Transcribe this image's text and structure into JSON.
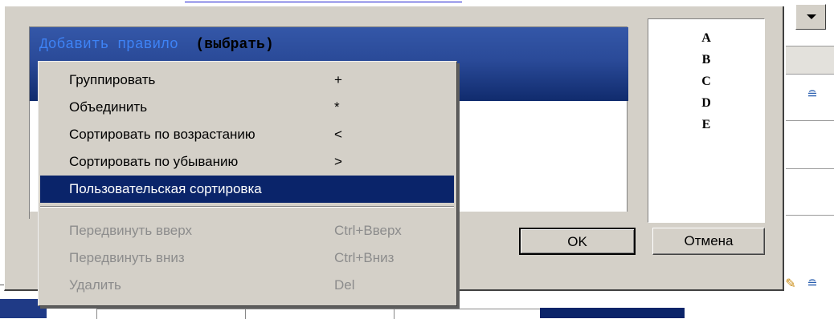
{
  "dialog": {
    "rule_text": "Добавить правило",
    "rule_action": "(выбрать)",
    "preview_letters": [
      "A",
      "B",
      "C",
      "D",
      "E"
    ],
    "ok_label": "OK",
    "cancel_label": "Отмена"
  },
  "context_menu": {
    "items": [
      {
        "label": "Группировать",
        "shortcut": "+"
      },
      {
        "label": "Объединить",
        "shortcut": "*"
      },
      {
        "label": "Сортировать по возрастанию",
        "shortcut": "<"
      },
      {
        "label": "Сортировать по убыванию",
        "shortcut": ">"
      },
      {
        "label": "Пользовательская сортировка",
        "shortcut": ""
      }
    ],
    "disabled_items": [
      {
        "label": "Передвинуть вверх",
        "shortcut": "Ctrl+Вверх"
      },
      {
        "label": "Передвинуть вниз",
        "shortcut": "Ctrl+Вниз"
      },
      {
        "label": "Удалить",
        "shortcut": "Del"
      }
    ],
    "selected_index": 4
  },
  "icons": {
    "dropdown": "chevron-down-icon",
    "side_sort": "sort-icon",
    "edit": "pencil-icon"
  },
  "colors": {
    "selection": "#0a246a",
    "header_gradient_top": "#3457a8",
    "header_gradient_bottom": "#102b6d",
    "rule_text": "#3e83f6"
  }
}
